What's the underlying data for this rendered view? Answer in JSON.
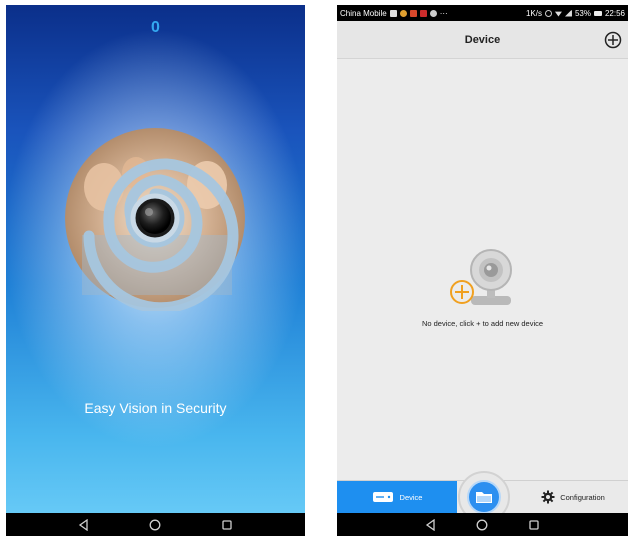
{
  "splash": {
    "counter": "0",
    "tagline": "Easy Vision in Security",
    "logo_icon": "camera-spiral-logo-icon"
  },
  "system_nav": {
    "back_icon": "back-triangle-icon",
    "home_icon": "home-circle-icon",
    "recents_icon": "recents-square-icon"
  },
  "status_bar": {
    "carrier": "China Mobile",
    "speed": "1K/s",
    "battery": "53%",
    "time": "22:56"
  },
  "device_screen": {
    "title": "Device",
    "add_icon": "plus-circle-icon",
    "empty_message": "No device, click + to add new device",
    "empty_icon": "webcam-add-icon"
  },
  "tab_bar": {
    "device_label": "Device",
    "configuration_label": "Configuration",
    "center_icon": "folder-icon"
  },
  "colors": {
    "accent_blue": "#1e8ff0",
    "add_orange": "#f0a020"
  }
}
